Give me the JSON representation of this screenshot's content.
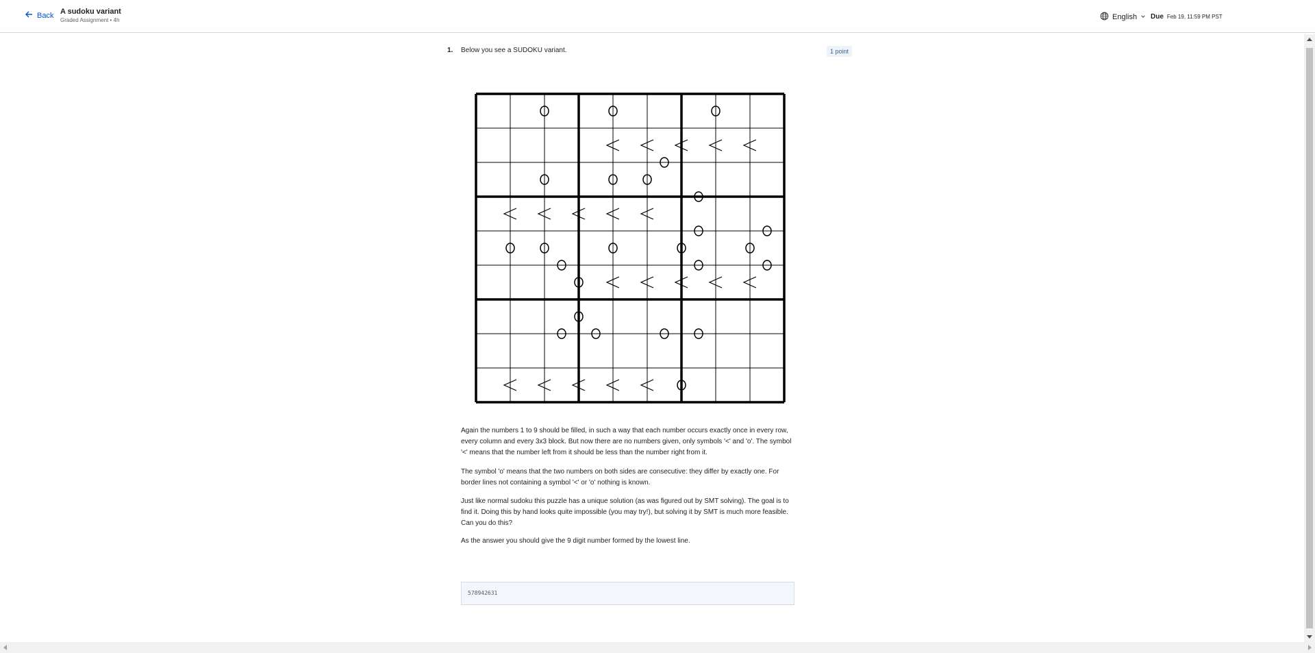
{
  "header": {
    "back_label": "Back",
    "title": "A sudoku variant",
    "subtitle": "Graded Assignment • 4h",
    "language": "English",
    "due_label": "Due",
    "due_date": "Feb 19, 11:59 PM PST"
  },
  "question": {
    "number": "1.",
    "prompt": "Below you see a SUDOKU variant.",
    "points": "1 point",
    "paragraphs": [
      "Again the numbers 1 to 9 should be filled, in such a way that each number occurs exactly once in every row, every column and every 3x3 block. But now there are no numbers given, only symbols '<' and 'o'. The symbol '<' means that the number left from it should be less than the number right from it.",
      "The symbol 'o' means that the two numbers on both sides are consecutive: they differ by exactly one. For border lines not containing a symbol '<' or 'o' nothing is known.",
      "Just like normal sudoku this puzzle has a unique solution (as was figured out by SMT solving). The goal is to find it. Doing this by hand looks quite impossible (you may try!), but solving it by SMT is much more feasible. Can you do this?",
      "As the answer you should give the 9 digit number formed by the lowest line."
    ],
    "answer_value": "578942631"
  },
  "puzzle": {
    "vertical_o": [
      [
        0,
        1
      ],
      [
        0,
        3
      ],
      [
        0,
        6
      ],
      [
        2,
        1
      ],
      [
        2,
        3
      ],
      [
        2,
        4
      ],
      [
        4,
        0
      ],
      [
        4,
        1
      ],
      [
        4,
        3
      ],
      [
        4,
        5
      ],
      [
        4,
        7
      ],
      [
        5,
        2
      ],
      [
        6,
        2
      ],
      [
        8,
        5
      ]
    ],
    "vertical_lt": [
      [
        1,
        3
      ],
      [
        1,
        4
      ],
      [
        1,
        5
      ],
      [
        1,
        6
      ],
      [
        1,
        7
      ],
      [
        3,
        0
      ],
      [
        3,
        1
      ],
      [
        3,
        2
      ],
      [
        3,
        3
      ],
      [
        3,
        4
      ],
      [
        5,
        3
      ],
      [
        5,
        4
      ],
      [
        5,
        5
      ],
      [
        5,
        6
      ],
      [
        5,
        7
      ],
      [
        8,
        0
      ],
      [
        8,
        1
      ],
      [
        8,
        2
      ],
      [
        8,
        3
      ],
      [
        8,
        4
      ]
    ],
    "horizontal_o": [
      [
        1,
        5
      ],
      [
        2,
        6
      ],
      [
        3,
        6
      ],
      [
        3,
        8
      ],
      [
        4,
        2
      ],
      [
        4,
        6
      ],
      [
        4,
        8
      ],
      [
        6,
        2
      ],
      [
        6,
        3
      ],
      [
        6,
        5
      ],
      [
        6,
        6
      ]
    ]
  }
}
